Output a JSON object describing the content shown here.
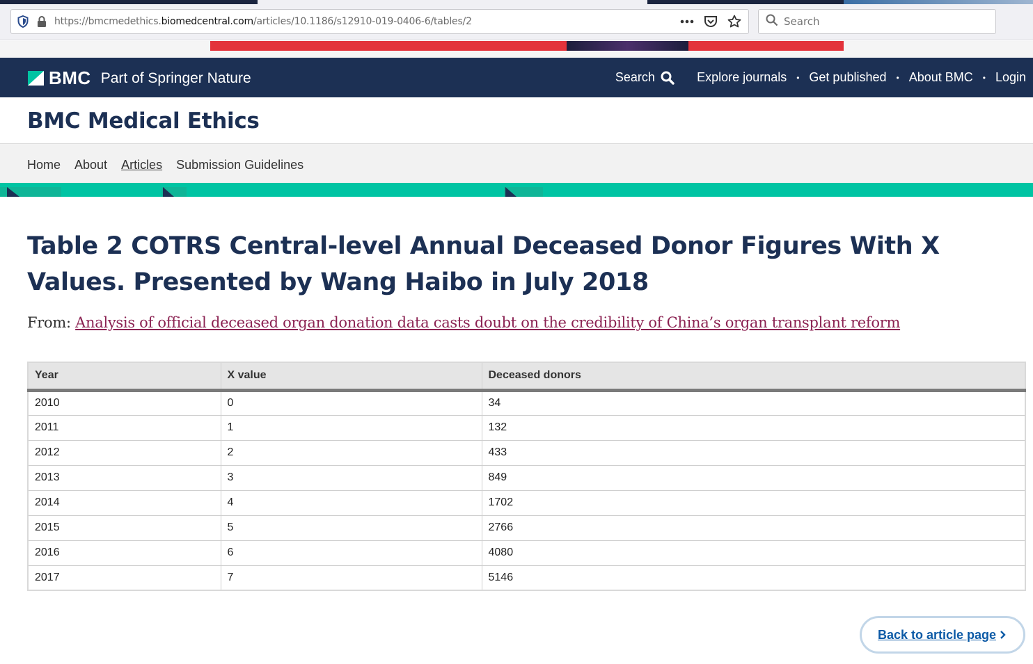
{
  "browser": {
    "url_prefix": "https://bmcmedethics.",
    "url_domain": "biomedcentral.com",
    "url_path": "/articles/10.1186/s12910-019-0406-6/tables/2",
    "search_placeholder": "Search",
    "icons": [
      "shield-icon",
      "lock-icon",
      "more-icon",
      "pocket-icon",
      "star-icon",
      "search-icon"
    ]
  },
  "header": {
    "brand": "BMC",
    "brand_sub": "Part of Springer Nature",
    "nav": [
      {
        "label": "Search"
      },
      {
        "label": "Explore journals"
      },
      {
        "label": "Get published"
      },
      {
        "label": "About BMC"
      },
      {
        "label": "Login"
      }
    ],
    "separator": "•"
  },
  "journal": {
    "title": "BMC Medical Ethics",
    "nav": [
      "Home",
      "About",
      "Articles",
      "Submission Guidelines"
    ],
    "current": "Articles"
  },
  "main": {
    "title": "Table 2 COTRS Central-level Annual Deceased Donor Figures With X Values. Presented by Wang Haibo in July 2018",
    "from_label": "From:",
    "from_link": "Analysis of official deceased organ donation data casts doubt on the credibility of China’s organ transplant reform",
    "table": {
      "headers": [
        "Year",
        "X value",
        "Deceased donors"
      ],
      "rows": [
        [
          "2010",
          "0",
          "34"
        ],
        [
          "2011",
          "1",
          "132"
        ],
        [
          "2012",
          "2",
          "433"
        ],
        [
          "2013",
          "3",
          "849"
        ],
        [
          "2014",
          "4",
          "1702"
        ],
        [
          "2015",
          "5",
          "2766"
        ],
        [
          "2016",
          "6",
          "4080"
        ],
        [
          "2017",
          "7",
          "5146"
        ]
      ]
    },
    "back_label": "Back to article page"
  },
  "colors": {
    "navy": "#1c3054",
    "teal": "#00c4a3",
    "link": "#8b2252",
    "button": "#0c5aa6"
  }
}
